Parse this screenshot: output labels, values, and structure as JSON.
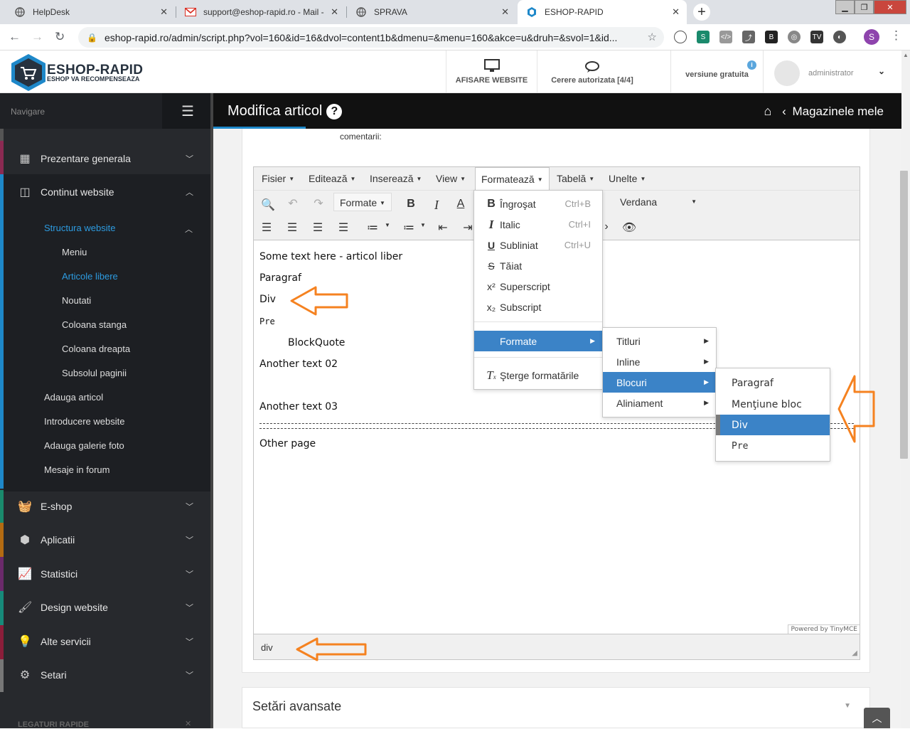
{
  "browser": {
    "tabs": [
      {
        "title": "HelpDesk",
        "icon": "globe-icon"
      },
      {
        "title": "support@eshop-rapid.ro - Mail -",
        "icon": "mail-icon"
      },
      {
        "title": "SPRAVA",
        "icon": "globe-icon"
      },
      {
        "title": "ESHOP-RAPID",
        "icon": "eshop-icon",
        "active": true
      }
    ],
    "new_tab": "+",
    "url": "eshop-rapid.ro/admin/script.php?vol=160&id=16&dvol=content1b&dmenu=&menu=160&akce=u&druh=&svol=1&id...",
    "profile_initial": "S"
  },
  "header": {
    "brand": "ESHOP-RAPID",
    "tagline": "ESHOP VA RECOMPENSEAZA",
    "view_site": "AFISARE WEBSITE",
    "requests": "Cerere autorizata [4/4]",
    "version": "versiune gratuita",
    "user": "administrator"
  },
  "sidebar": {
    "nav_label": "Navigare",
    "items": [
      {
        "label": "Prezentare generala",
        "icon": "grid-icon",
        "color": "#8b2a52"
      },
      {
        "label": "Continut website",
        "icon": "layout-icon",
        "color": "#1e88c9"
      },
      {
        "label": "E-shop",
        "icon": "basket-icon",
        "color": "#1a8a6c"
      },
      {
        "label": "Aplicatii",
        "icon": "cubes-icon",
        "color": "#b36b12"
      },
      {
        "label": "Statistici",
        "icon": "chart-icon",
        "color": "#6b2a6b"
      },
      {
        "label": "Design website",
        "icon": "brush-icon",
        "color": "#178a7a"
      },
      {
        "label": "Alte servicii",
        "icon": "bulb-icon",
        "color": "#8b1e3a"
      },
      {
        "label": "Setari",
        "icon": "gears-icon",
        "color": "#777777"
      }
    ],
    "sub": {
      "structura": "Structura website",
      "children": [
        "Meniu",
        "Articole libere",
        "Noutati",
        "Coloana stanga",
        "Coloana dreapta",
        "Subsolul paginii"
      ],
      "others": [
        "Adauga articol",
        "Introducere website",
        "Adauga galerie foto",
        "Mesaje in forum"
      ]
    },
    "bottom_label": "LEGATURI RAPIDE"
  },
  "page": {
    "title": "Modifica articol",
    "breadcrumb": "Magazinele mele",
    "comments_label": "comentarii:",
    "advanced": "Setări avansate"
  },
  "editor": {
    "menubar": [
      "Fisier",
      "Editează",
      "Inserează",
      "View",
      "Formatează",
      "Tabelă",
      "Unelte"
    ],
    "format_dropdown": "Formate",
    "font": "Verdana",
    "content": {
      "p1": "Some text here - articol liber",
      "p2": "Paragraf",
      "p3": "Div",
      "p4": "Pre",
      "p5": "BlockQuote",
      "p6": "Another text 02",
      "p7": "Another text 03",
      "p8": "Other page"
    },
    "powered": "Powered by TinyMCE",
    "path": "div"
  },
  "format_menu": {
    "items": [
      {
        "label": "Îngroşat",
        "shortcut": "Ctrl+B",
        "icon": "bold-icon"
      },
      {
        "label": "Italic",
        "shortcut": "Ctrl+I",
        "icon": "italic-icon"
      },
      {
        "label": "Subliniat",
        "shortcut": "Ctrl+U",
        "icon": "underline-icon"
      },
      {
        "label": "Tăiat",
        "shortcut": "",
        "icon": "strikethrough-icon"
      },
      {
        "label": "Superscript",
        "shortcut": "",
        "icon": "superscript-icon"
      },
      {
        "label": "Subscript",
        "shortcut": "",
        "icon": "subscript-icon"
      }
    ],
    "formats": "Formate",
    "clear": "Şterge formatările"
  },
  "formats_submenu": [
    "Titluri",
    "Inline",
    "Blocuri",
    "Aliniament"
  ],
  "blocks_submenu": [
    "Paragraf",
    "Menţiune bloc",
    "Div",
    "Pre"
  ],
  "colors": {
    "accent": "#1e88c9",
    "selected": "#3b83c7",
    "arrow": "#f58220"
  }
}
